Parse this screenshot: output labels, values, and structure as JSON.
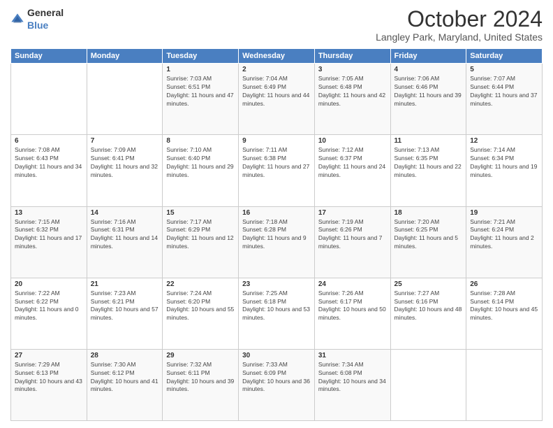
{
  "header": {
    "logo_general": "General",
    "logo_blue": "Blue",
    "month": "October 2024",
    "location": "Langley Park, Maryland, United States"
  },
  "weekdays": [
    "Sunday",
    "Monday",
    "Tuesday",
    "Wednesday",
    "Thursday",
    "Friday",
    "Saturday"
  ],
  "weeks": [
    [
      {
        "day": "",
        "content": ""
      },
      {
        "day": "",
        "content": ""
      },
      {
        "day": "1",
        "content": "Sunrise: 7:03 AM\nSunset: 6:51 PM\nDaylight: 11 hours and 47 minutes."
      },
      {
        "day": "2",
        "content": "Sunrise: 7:04 AM\nSunset: 6:49 PM\nDaylight: 11 hours and 44 minutes."
      },
      {
        "day": "3",
        "content": "Sunrise: 7:05 AM\nSunset: 6:48 PM\nDaylight: 11 hours and 42 minutes."
      },
      {
        "day": "4",
        "content": "Sunrise: 7:06 AM\nSunset: 6:46 PM\nDaylight: 11 hours and 39 minutes."
      },
      {
        "day": "5",
        "content": "Sunrise: 7:07 AM\nSunset: 6:44 PM\nDaylight: 11 hours and 37 minutes."
      }
    ],
    [
      {
        "day": "6",
        "content": "Sunrise: 7:08 AM\nSunset: 6:43 PM\nDaylight: 11 hours and 34 minutes."
      },
      {
        "day": "7",
        "content": "Sunrise: 7:09 AM\nSunset: 6:41 PM\nDaylight: 11 hours and 32 minutes."
      },
      {
        "day": "8",
        "content": "Sunrise: 7:10 AM\nSunset: 6:40 PM\nDaylight: 11 hours and 29 minutes."
      },
      {
        "day": "9",
        "content": "Sunrise: 7:11 AM\nSunset: 6:38 PM\nDaylight: 11 hours and 27 minutes."
      },
      {
        "day": "10",
        "content": "Sunrise: 7:12 AM\nSunset: 6:37 PM\nDaylight: 11 hours and 24 minutes."
      },
      {
        "day": "11",
        "content": "Sunrise: 7:13 AM\nSunset: 6:35 PM\nDaylight: 11 hours and 22 minutes."
      },
      {
        "day": "12",
        "content": "Sunrise: 7:14 AM\nSunset: 6:34 PM\nDaylight: 11 hours and 19 minutes."
      }
    ],
    [
      {
        "day": "13",
        "content": "Sunrise: 7:15 AM\nSunset: 6:32 PM\nDaylight: 11 hours and 17 minutes."
      },
      {
        "day": "14",
        "content": "Sunrise: 7:16 AM\nSunset: 6:31 PM\nDaylight: 11 hours and 14 minutes."
      },
      {
        "day": "15",
        "content": "Sunrise: 7:17 AM\nSunset: 6:29 PM\nDaylight: 11 hours and 12 minutes."
      },
      {
        "day": "16",
        "content": "Sunrise: 7:18 AM\nSunset: 6:28 PM\nDaylight: 11 hours and 9 minutes."
      },
      {
        "day": "17",
        "content": "Sunrise: 7:19 AM\nSunset: 6:26 PM\nDaylight: 11 hours and 7 minutes."
      },
      {
        "day": "18",
        "content": "Sunrise: 7:20 AM\nSunset: 6:25 PM\nDaylight: 11 hours and 5 minutes."
      },
      {
        "day": "19",
        "content": "Sunrise: 7:21 AM\nSunset: 6:24 PM\nDaylight: 11 hours and 2 minutes."
      }
    ],
    [
      {
        "day": "20",
        "content": "Sunrise: 7:22 AM\nSunset: 6:22 PM\nDaylight: 11 hours and 0 minutes."
      },
      {
        "day": "21",
        "content": "Sunrise: 7:23 AM\nSunset: 6:21 PM\nDaylight: 10 hours and 57 minutes."
      },
      {
        "day": "22",
        "content": "Sunrise: 7:24 AM\nSunset: 6:20 PM\nDaylight: 10 hours and 55 minutes."
      },
      {
        "day": "23",
        "content": "Sunrise: 7:25 AM\nSunset: 6:18 PM\nDaylight: 10 hours and 53 minutes."
      },
      {
        "day": "24",
        "content": "Sunrise: 7:26 AM\nSunset: 6:17 PM\nDaylight: 10 hours and 50 minutes."
      },
      {
        "day": "25",
        "content": "Sunrise: 7:27 AM\nSunset: 6:16 PM\nDaylight: 10 hours and 48 minutes."
      },
      {
        "day": "26",
        "content": "Sunrise: 7:28 AM\nSunset: 6:14 PM\nDaylight: 10 hours and 45 minutes."
      }
    ],
    [
      {
        "day": "27",
        "content": "Sunrise: 7:29 AM\nSunset: 6:13 PM\nDaylight: 10 hours and 43 minutes."
      },
      {
        "day": "28",
        "content": "Sunrise: 7:30 AM\nSunset: 6:12 PM\nDaylight: 10 hours and 41 minutes."
      },
      {
        "day": "29",
        "content": "Sunrise: 7:32 AM\nSunset: 6:11 PM\nDaylight: 10 hours and 39 minutes."
      },
      {
        "day": "30",
        "content": "Sunrise: 7:33 AM\nSunset: 6:09 PM\nDaylight: 10 hours and 36 minutes."
      },
      {
        "day": "31",
        "content": "Sunrise: 7:34 AM\nSunset: 6:08 PM\nDaylight: 10 hours and 34 minutes."
      },
      {
        "day": "",
        "content": ""
      },
      {
        "day": "",
        "content": ""
      }
    ]
  ]
}
